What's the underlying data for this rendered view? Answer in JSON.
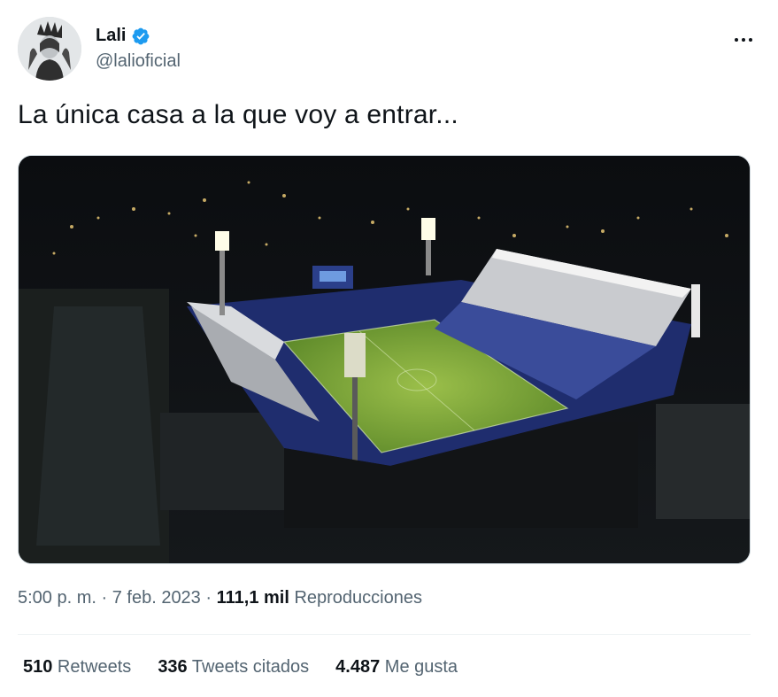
{
  "author": {
    "name": "Lali",
    "handle": "@lalioficial",
    "verified_color": "#1d9bf0"
  },
  "tweet": {
    "text": "La única casa a la que voy a entrar...",
    "media": {
      "kind": "photo",
      "icon": "stadium-night-aerial"
    }
  },
  "meta": {
    "time": "5:00 p. m.",
    "sep1": " · ",
    "date": "7 feb. 2023",
    "sep2": " · ",
    "views_count": "111,1 mil",
    "views_label": " Reproducciones"
  },
  "stats": {
    "retweets_count": "510",
    "retweets_label": " Retweets",
    "quotes_count": "336",
    "quotes_label": " Tweets citados",
    "likes_count": "4.487",
    "likes_label": " Me gusta"
  },
  "colors": {
    "text_primary": "#0f1419",
    "text_secondary": "#536471",
    "divider": "#eff3f4",
    "accent": "#1d9bf0"
  }
}
